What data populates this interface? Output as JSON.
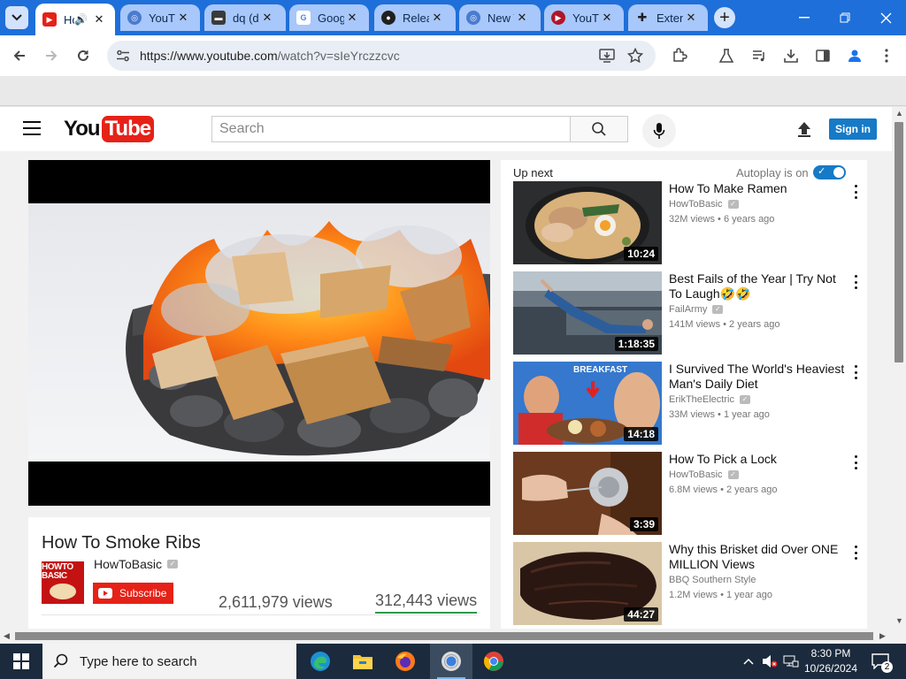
{
  "browser": {
    "tabs": [
      {
        "title": "How To Smoke Ribs",
        "active": true
      },
      {
        "title": "YouTube"
      },
      {
        "title": "dq (discussion)"
      },
      {
        "title": "Google"
      },
      {
        "title": "Releases"
      },
      {
        "title": "New Tab"
      },
      {
        "title": "YouTube"
      },
      {
        "title": "Extensions"
      }
    ],
    "tab_icons": [
      "youtube-icon",
      "globe-icon",
      "dq-icon",
      "google-icon",
      "github-icon",
      "globe-icon",
      "youtube-icon",
      "puzzle-icon"
    ],
    "url_main": "https://www.youtube.com",
    "url_rest": "/watch?v=sIeYrczzcvc"
  },
  "youtube": {
    "logo_you": "You",
    "logo_tube": "Tube",
    "search_placeholder": "Search",
    "signin_label": "Sign in",
    "video": {
      "title": "How To Smoke Ribs",
      "channel": "HowToBasic",
      "channel_avatar_text": "HOWTO BASIC",
      "subscribe_label": "Subscribe",
      "views": "2,611,979 views",
      "views_alt": "312,443 views"
    },
    "sidebar": {
      "up_next": "Up next",
      "autoplay_label": "Autoplay is on",
      "items": [
        {
          "title": "How To Make Ramen",
          "channel": "HowToBasic",
          "views": "32M views",
          "age": "6 years ago",
          "duration": "10:24"
        },
        {
          "title": "Best Fails of the Year | Try Not To Laugh🤣🤣",
          "channel": "FailArmy",
          "views": "141M views",
          "age": "2 years ago",
          "duration": "1:18:35"
        },
        {
          "title": "I Survived The World's Heaviest Man's Daily Diet",
          "channel": "ErikTheElectric",
          "views": "33M views",
          "age": "1 year ago",
          "duration": "14:18",
          "thumb_text": "BREAKFAST"
        },
        {
          "title": "How To Pick a Lock",
          "channel": "HowToBasic",
          "views": "6.8M views",
          "age": "2 years ago",
          "duration": "3:39"
        },
        {
          "title": "Why this Brisket did Over ONE MILLION Views",
          "channel": "BBQ Southern Style",
          "views": "1.2M views",
          "age": "1 year ago",
          "duration": "44:27"
        }
      ]
    }
  },
  "taskbar": {
    "search_placeholder": "Type here to search",
    "time": "8:30 PM",
    "date": "10/26/2024",
    "notification_count": "2",
    "apps": [
      "edge-icon",
      "file-explorer-icon",
      "firefox-icon",
      "chrome-icon",
      "chrome-icon"
    ]
  },
  "colors": {
    "chrome_blue": "#1e6fd9",
    "youtube_red": "#e62117",
    "signin_blue": "#167ac6",
    "taskbar": "#1b2a3d"
  }
}
